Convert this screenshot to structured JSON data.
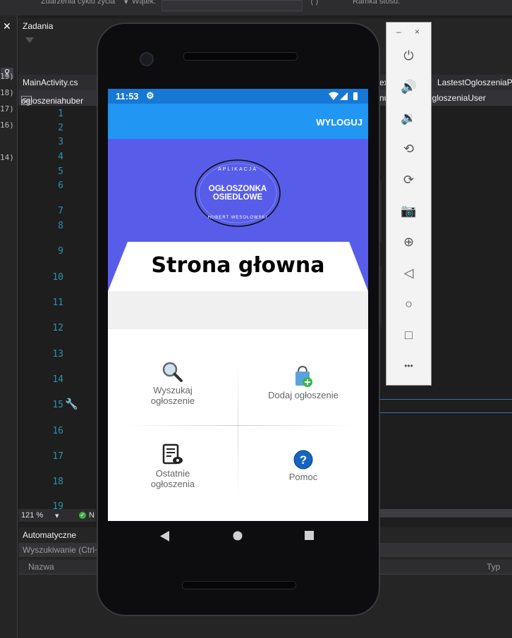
{
  "ide": {
    "topbar": {
      "events_label": "Zdarzenia cyklu życia",
      "thread_label": "Wątek:",
      "stack_label": "Ramka stosu:"
    },
    "tasks_panel": {
      "title": "Zadania"
    },
    "tabs": [
      {
        "label": "MainActivity.cs"
      },
      {
        "label": "ex"
      },
      {
        "label": "LastestOgloszeniaPa"
      }
    ],
    "nav": {
      "project": "ogloszeniahuber",
      "member": ".OgloszeniaUser",
      "member_prefix": "nu"
    },
    "line_numbers": [
      "1",
      "2",
      "3",
      "4",
      "5",
      "6",
      "7",
      "8",
      "9",
      "10",
      "11",
      "12",
      "13",
      "14",
      "15",
      "16",
      "17",
      "18",
      "19"
    ],
    "left_numbers": [
      "19)",
      "18)",
      "17)",
      "16)",
      "14)"
    ],
    "zoom": "121 %",
    "status_ok": "N",
    "auto_panel": {
      "title": "Automatyczne",
      "search_placeholder": "Wyszukiwanie (Ctrl+",
      "col_name": "Nazwa",
      "col_type": "Typ"
    }
  },
  "emulator_toolbar": {
    "minimize": "–",
    "close": "×",
    "buttons": [
      {
        "name": "power-icon",
        "glyph": "⏻"
      },
      {
        "name": "volume-up-icon",
        "glyph": "🔊"
      },
      {
        "name": "volume-down-icon",
        "glyph": "🔉"
      },
      {
        "name": "rotate-left-icon",
        "glyph": "⟲"
      },
      {
        "name": "rotate-right-icon",
        "glyph": "⟳"
      },
      {
        "name": "camera-icon",
        "glyph": "📷"
      },
      {
        "name": "zoom-icon",
        "glyph": "⊕"
      },
      {
        "name": "back-icon",
        "glyph": "◁"
      },
      {
        "name": "home-icon",
        "glyph": "○"
      },
      {
        "name": "overview-icon",
        "glyph": "□"
      },
      {
        "name": "more-icon",
        "glyph": "•••"
      }
    ]
  },
  "phone": {
    "status_bar": {
      "time": "11:53",
      "settings_glyph": "⚙"
    },
    "app_bar": {
      "logout_label": "WYLOGUJ"
    },
    "logo": {
      "top_text": "APLIKACJA",
      "line1": "OGŁOSZONKA",
      "line2": "OSIEDLOWE",
      "bottom_text": "HUBERT WESOŁOWSKI"
    },
    "banner_title": "Strona głowna",
    "tiles": [
      {
        "id": "search",
        "line1": "Wyszukaj",
        "line2": "ogłoszenie"
      },
      {
        "id": "add",
        "line1": "Dodaj ogłoszenie",
        "line2": ""
      },
      {
        "id": "recent",
        "line1": "Ostatnie",
        "line2": "ogłoszenia"
      },
      {
        "id": "help",
        "line1": "Pomoc",
        "line2": ""
      }
    ]
  },
  "colors": {
    "status_bar": "#1777d4",
    "app_bar": "#2196f3",
    "banner": "#575de9",
    "ide_bg": "#1e1e1e",
    "line_number": "#2b91af"
  }
}
